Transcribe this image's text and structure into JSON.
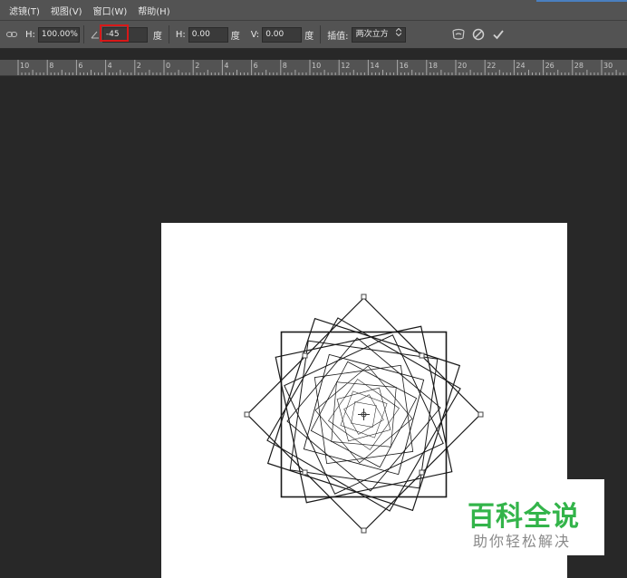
{
  "menubar": {
    "items": [
      "滤镜(T)",
      "视图(V)",
      "窗口(W)",
      "帮助(H)"
    ]
  },
  "options": {
    "link_icon": "link-icon",
    "h_label": "H:",
    "h_value": "100.00%",
    "angle_icon": "angle-icon",
    "angle_value": "-45",
    "angle_unit": "度",
    "skew_h_label": "H:",
    "skew_h_value": "0.00",
    "skew_h_unit": "度",
    "skew_v_label": "V:",
    "skew_v_value": "0.00",
    "skew_v_unit": "度",
    "interp_label": "插值:",
    "interp_value": "两次立方",
    "warp_icon": "warp-icon",
    "cancel_icon": "cancel-icon",
    "commit_icon": "check-icon"
  },
  "ruler": {
    "labels": [
      "10",
      "8",
      "6",
      "4",
      "2",
      "0",
      "2",
      "4",
      "6",
      "8",
      "10",
      "12",
      "14",
      "16",
      "18",
      "20",
      "22",
      "24",
      "26",
      "28",
      "30"
    ]
  },
  "watermark": {
    "title": "百科全说",
    "subtitle": "助你轻松解决"
  },
  "colors": {
    "panel": "#535353",
    "workspace": "#282828",
    "highlight": "#d81818",
    "watermark_green": "#33b44a"
  }
}
